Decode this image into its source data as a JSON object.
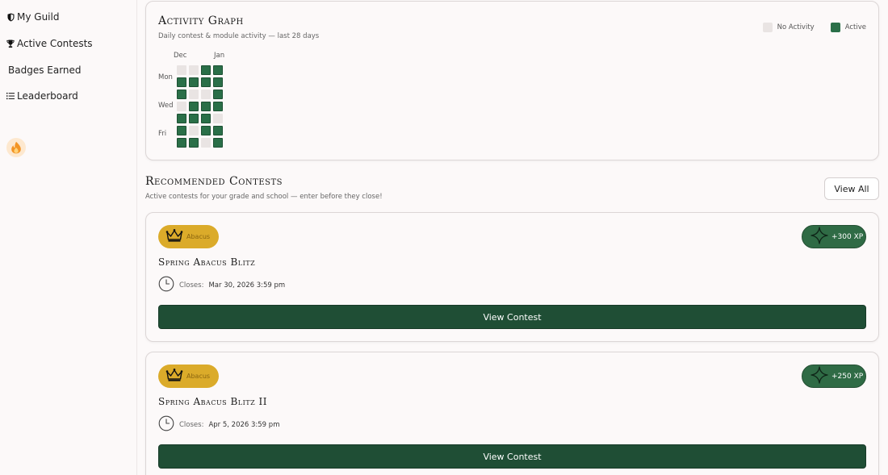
{
  "sidebar": {
    "items": [
      {
        "label": "My Guild",
        "icon": "shield-icon"
      },
      {
        "label": "Active Contests",
        "icon": "trophy-icon"
      },
      {
        "label": "Badges Earned",
        "icon": ""
      },
      {
        "label": "Leaderboard",
        "icon": "list-icon"
      }
    ],
    "streak_icon": "flame-icon"
  },
  "activity": {
    "title": "Activity Graph",
    "subtitle": "Daily contest & module activity — last 28 days",
    "legend": {
      "none_label": "No Activity",
      "active_label": "Active"
    },
    "colors": {
      "none": "#e9e4e3",
      "active": "#2a6f48"
    },
    "months": [
      "Dec",
      "Jan"
    ],
    "day_labels": [
      "Mon",
      "Wed",
      "Fri"
    ],
    "grid": [
      [
        0,
        0,
        1,
        1
      ],
      [
        1,
        1,
        1,
        1
      ],
      [
        1,
        0,
        0,
        1
      ],
      [
        0,
        1,
        1,
        1
      ],
      [
        1,
        1,
        1,
        0
      ],
      [
        1,
        0,
        1,
        1
      ],
      [
        1,
        1,
        0,
        1
      ]
    ]
  },
  "recommended": {
    "title": "Recommended Contests",
    "subtitle": "Active contests for your grade and school — enter before they close!",
    "view_all_label": "View All",
    "contests": [
      {
        "tag": "Abacus",
        "xp": "+300 XP",
        "title": "Spring Abacus Blitz",
        "closes_label": "Closes:",
        "closes_value": "Mar 30, 2026 3:59 pm",
        "button": "View Contest"
      },
      {
        "tag": "Abacus",
        "xp": "+250 XP",
        "title": "Spring Abacus Blitz II",
        "closes_label": "Closes:",
        "closes_value": "Apr 5, 2026 3:59 pm",
        "button": "View Contest"
      }
    ]
  }
}
